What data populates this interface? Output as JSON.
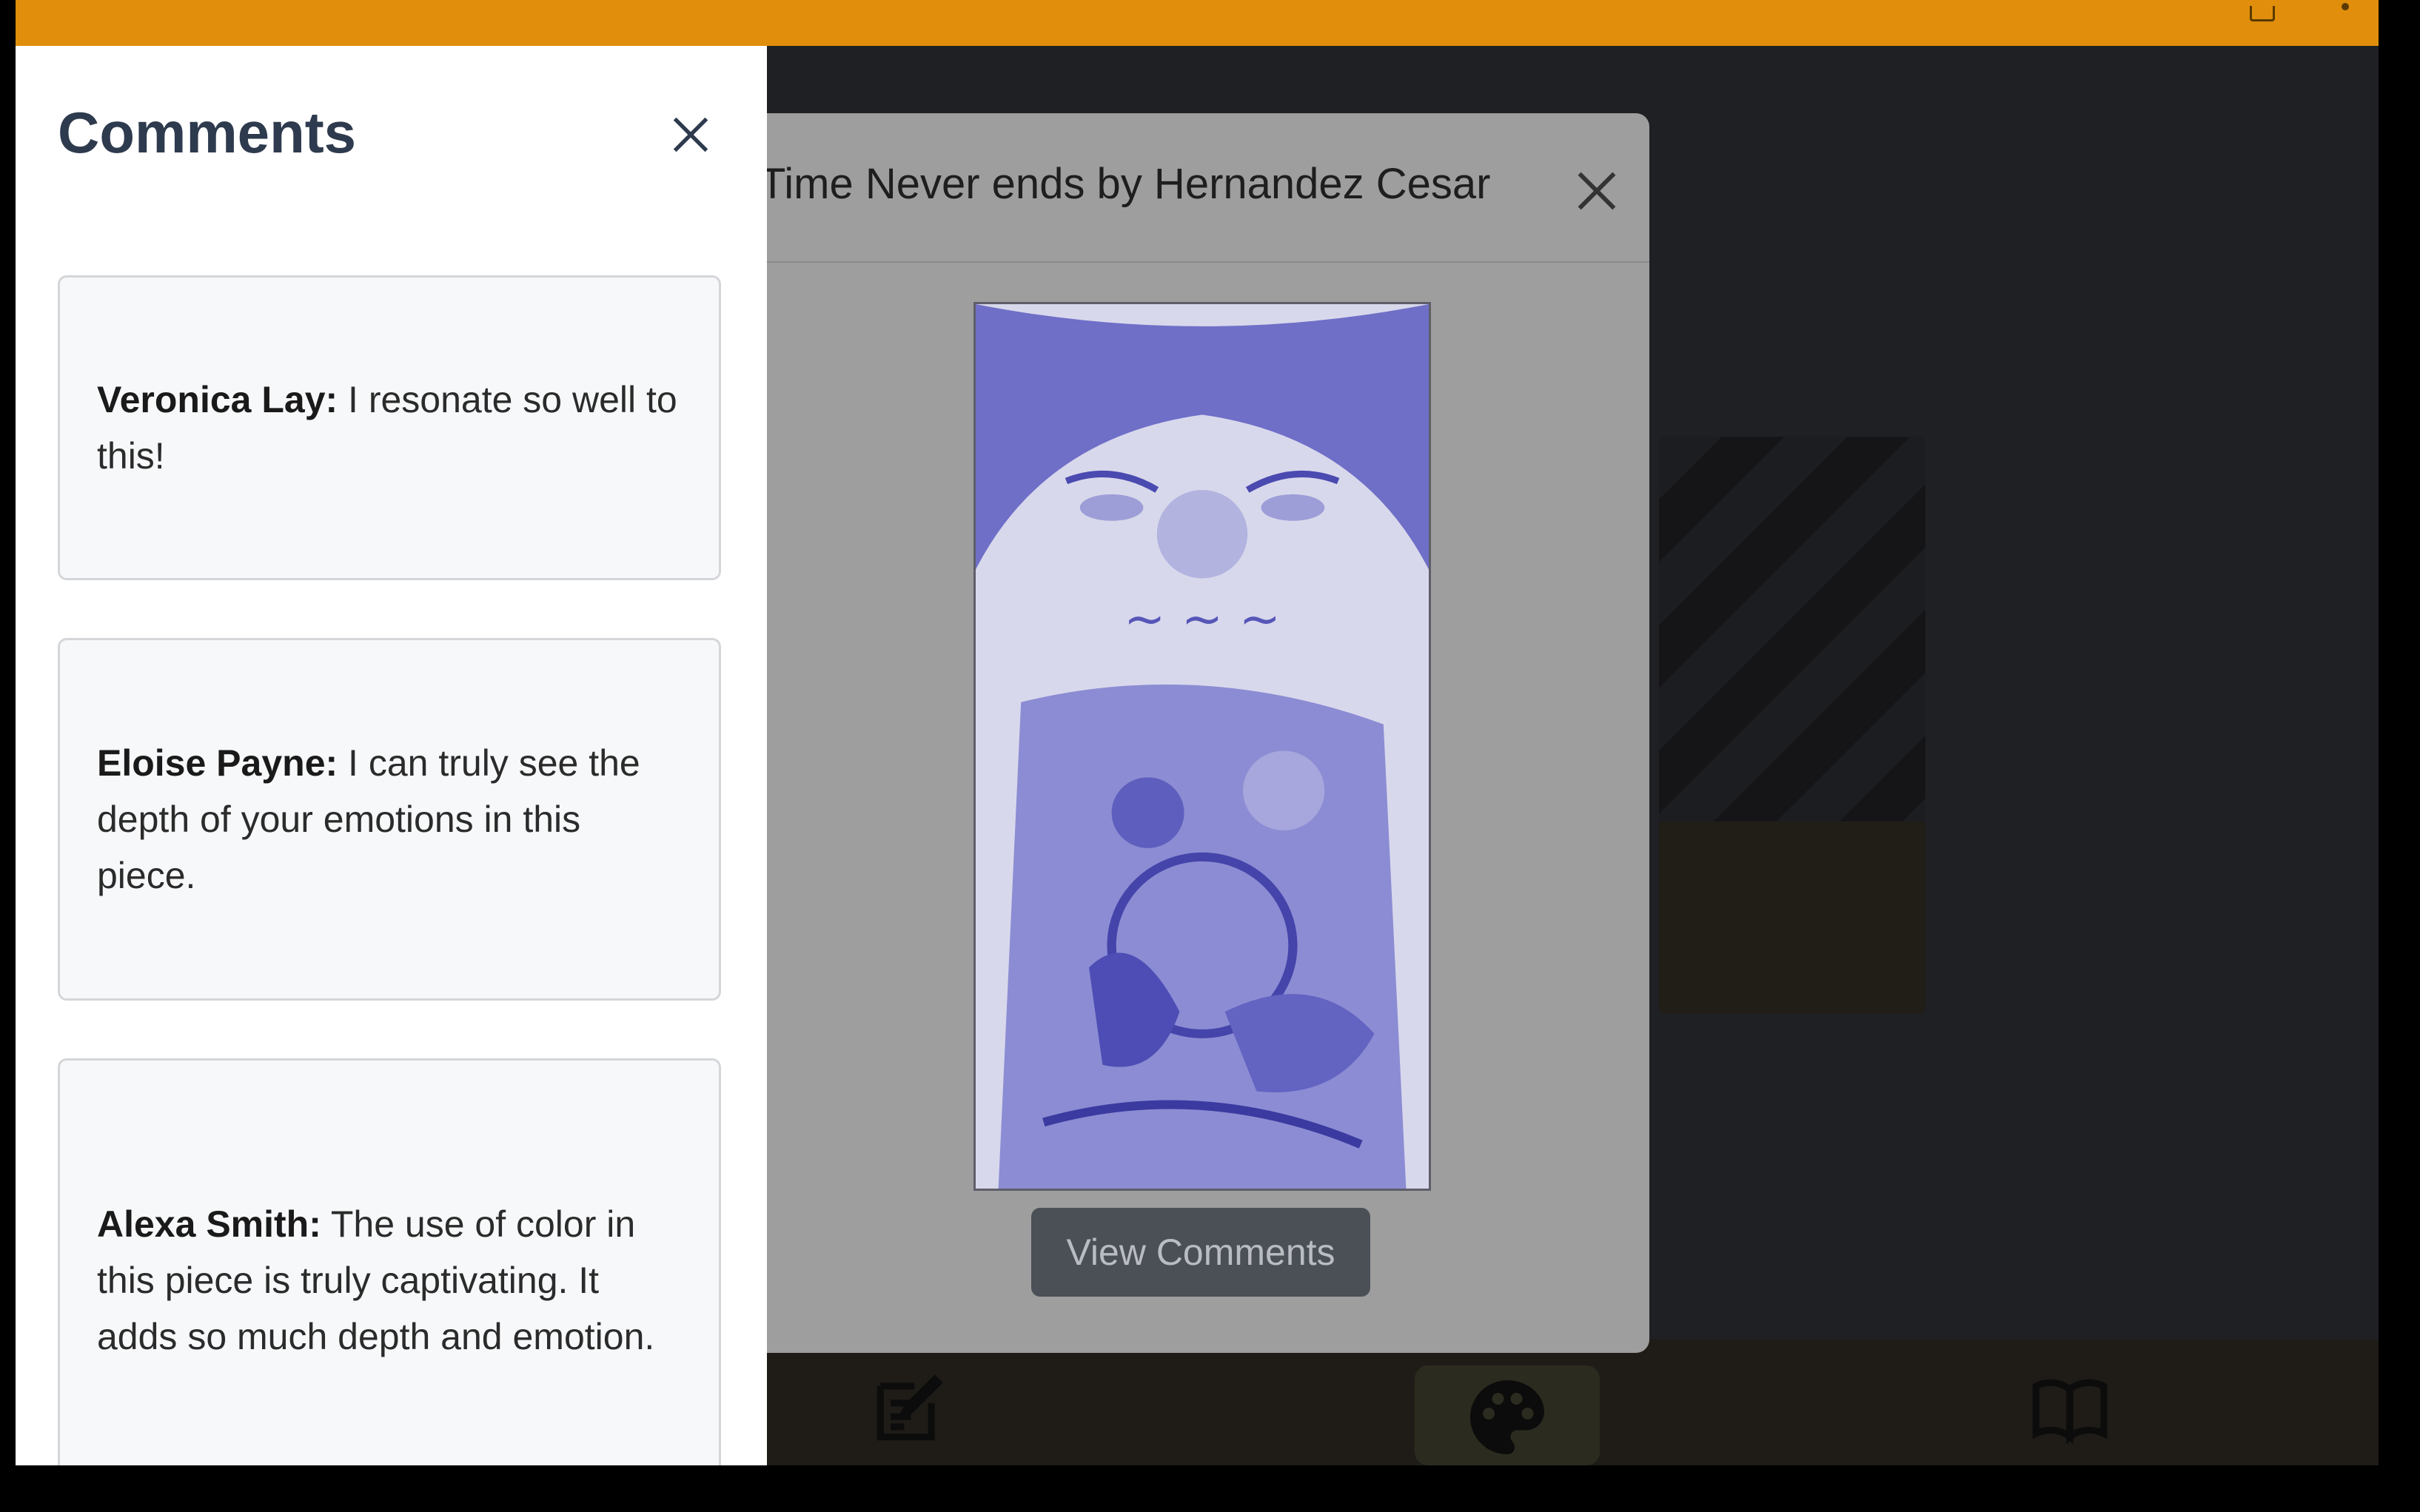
{
  "modal": {
    "title": "Time Never ends by Hernandez Cesar",
    "view_comments_label": "View Comments"
  },
  "drawer": {
    "title": "Comments",
    "comments": [
      {
        "author": "Veronica Lay:",
        "text": " I resonate so well to this!"
      },
      {
        "author": "Eloise Payne:",
        "text": " I can truly see the depth of your emotions in this piece."
      },
      {
        "author": "Alexa Smith:",
        "text": " The use of color in this piece is truly captivating. It adds so much depth and emotion."
      }
    ]
  },
  "nav": {
    "items": [
      {
        "icon": "pencil-square-icon"
      },
      {
        "icon": "palette-icon",
        "active": true
      },
      {
        "icon": "book-icon"
      }
    ]
  },
  "colors": {
    "status_bar": "#e08e0b",
    "drawer_title": "#2e3a4d",
    "button_bg": "#4b5057"
  }
}
